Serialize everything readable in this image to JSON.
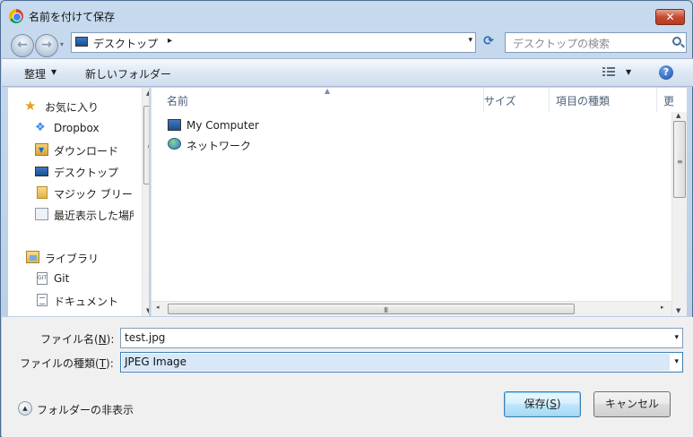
{
  "window": {
    "title": "名前を付けて保存",
    "close_label": "✕"
  },
  "nav": {
    "back_label": "←",
    "forward_label": "→",
    "dropdown_label": "▾"
  },
  "address": {
    "location": "デスクトップ",
    "separator": "▸",
    "dropdown": "▾",
    "refresh": "⟳"
  },
  "search": {
    "placeholder": "デスクトップの検索"
  },
  "toolbar": {
    "organize_label": "整理",
    "organize_arrow": "▼",
    "new_folder_label": "新しいフォルダー",
    "view_arrow": "▼",
    "help_label": "?"
  },
  "sidebar": {
    "items": [
      {
        "label": "お気に入り",
        "icon": "star-icon"
      },
      {
        "label": "Dropbox",
        "icon": "dropbox-icon"
      },
      {
        "label": "ダウンロード",
        "icon": "downloads-folder-icon"
      },
      {
        "label": "デスクトップ",
        "icon": "desktop-icon"
      },
      {
        "label": "マジック ブリー",
        "icon": "folder-icon"
      },
      {
        "label": "最近表示した場所",
        "icon": "recent-places-icon"
      },
      {
        "label": "ライブラリ",
        "icon": "library-icon"
      },
      {
        "label": "Git",
        "icon": "git-doc-icon"
      },
      {
        "label": "ドキュメント",
        "icon": "documents-icon"
      }
    ],
    "scroll_up": "▲",
    "scroll_down": "▼",
    "grip": "≡"
  },
  "file_list": {
    "columns": [
      {
        "label": "名前"
      },
      {
        "label": "サイズ"
      },
      {
        "label": "項目の種類"
      },
      {
        "label": "更"
      }
    ],
    "sort_indicator": "▲",
    "rows": [
      {
        "name": "My Computer",
        "icon": "computer-icon"
      },
      {
        "name": "ネットワーク",
        "icon": "network-icon"
      }
    ],
    "scroll_up": "▲",
    "scroll_down": "▼",
    "scroll_left": "◂",
    "scroll_right": "▸",
    "grip": "≡",
    "hgrip": "III"
  },
  "form": {
    "filename_label": "ファイル名(",
    "filename_key": "N",
    "filename_label_end": "):",
    "filename_value": "test.jpg",
    "filetype_label": "ファイルの種類(",
    "filetype_key": "T",
    "filetype_label_end": "):",
    "filetype_value": "JPEG Image",
    "dropdown": "▾"
  },
  "footer": {
    "hide_folders_label": "フォルダーの非表示",
    "hide_folders_icon": "▲",
    "save_label": "保存(",
    "save_key": "S",
    "save_label_end": ")",
    "cancel_label": "キャンセル"
  },
  "colors": {
    "accent": "#3c7fb1",
    "selection": "#d8e8f8",
    "close": "#c54b32"
  }
}
